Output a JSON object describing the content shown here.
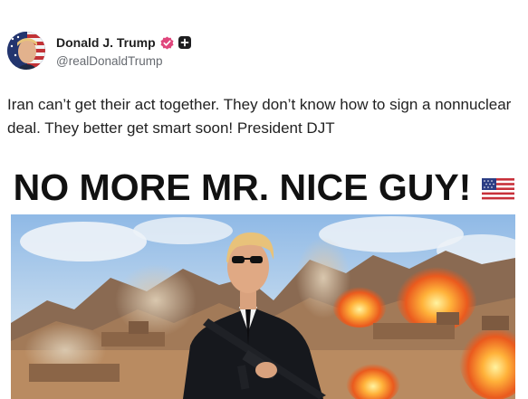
{
  "author": {
    "display_name": "Donald J. Trump",
    "handle": "@realDonaldTrump",
    "avatar_icon": "profile-photo-flag",
    "verified_icon": "verified-badge-icon",
    "verified_color": "#e0467c",
    "follow_icon": "plus-icon"
  },
  "post": {
    "text": "Iran can’t get their act together. They don’t know how to sign a nonnuclear deal. They better get smart soon! President DJT"
  },
  "image": {
    "headline": "NO MORE MR. NICE GUY!",
    "flag_icon": "us-flag-emoji"
  }
}
